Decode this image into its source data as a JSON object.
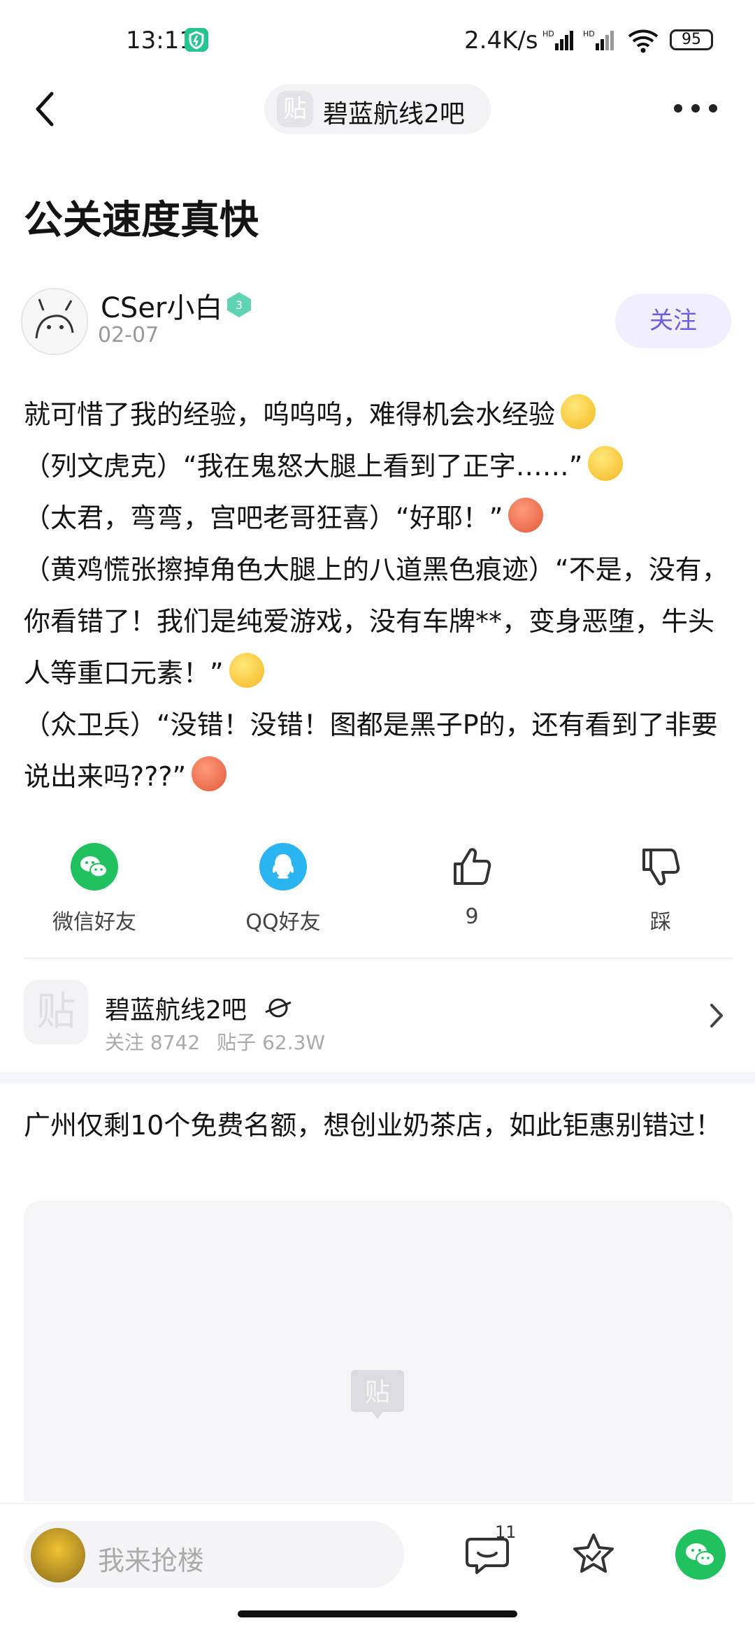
{
  "status_bar": {
    "time": "13:11",
    "net_speed": "2.4K/s",
    "signal_label": "HD",
    "battery": "95"
  },
  "nav": {
    "forum_chip_label": "碧蓝航线2吧",
    "forum_chip_icon": "贴"
  },
  "post": {
    "title": "公关速度真快",
    "author": "CSer小白",
    "level": "3",
    "date": "02-07",
    "follow_label": "关注",
    "paragraphs": [
      "就可惜了我的经验，呜呜呜，难得机会水经验",
      "（列文虎克）“我在鬼怒大腿上看到了正字……”",
      "（太君，弯弯，宫吧老哥狂喜）“好耶！”",
      "（黄鸡慌张擦掉角色大腿上的八道黑色痕迹）“不是，没有，你看错了！我们是纯爱游戏，没有车牌**，变身恶堕，牛头人等重口元素！”",
      "（众卫兵）“没错！没错！图都是黑子P的，还有看到了非要说出来吗???”"
    ],
    "emoji_colors": [
      "#f5c242",
      "#f5c242",
      "#e8604a",
      "#f5c242",
      "#e85a3a"
    ]
  },
  "actions": {
    "wechat_label": "微信好友",
    "qq_label": "QQ好友",
    "like_count": "9",
    "dislike_label": "踩",
    "wechat_color": "#20c15f",
    "qq_color": "#2ab4f2"
  },
  "forum_card": {
    "icon": "贴",
    "name": "碧蓝航线2吧",
    "follow_text": "关注 8742",
    "posts_text": "贴子 62.3W"
  },
  "ad": {
    "text": "广州仅剩10个免费名额，想创业奶茶店，如此钜惠别错过！"
  },
  "bottom_bar": {
    "reply_placeholder": "我来抢楼",
    "comment_count": "11"
  },
  "colors": {
    "accent": "#6b5ee0",
    "follow_bg": "#f1efff",
    "level_badge": "#5fd3b2"
  }
}
